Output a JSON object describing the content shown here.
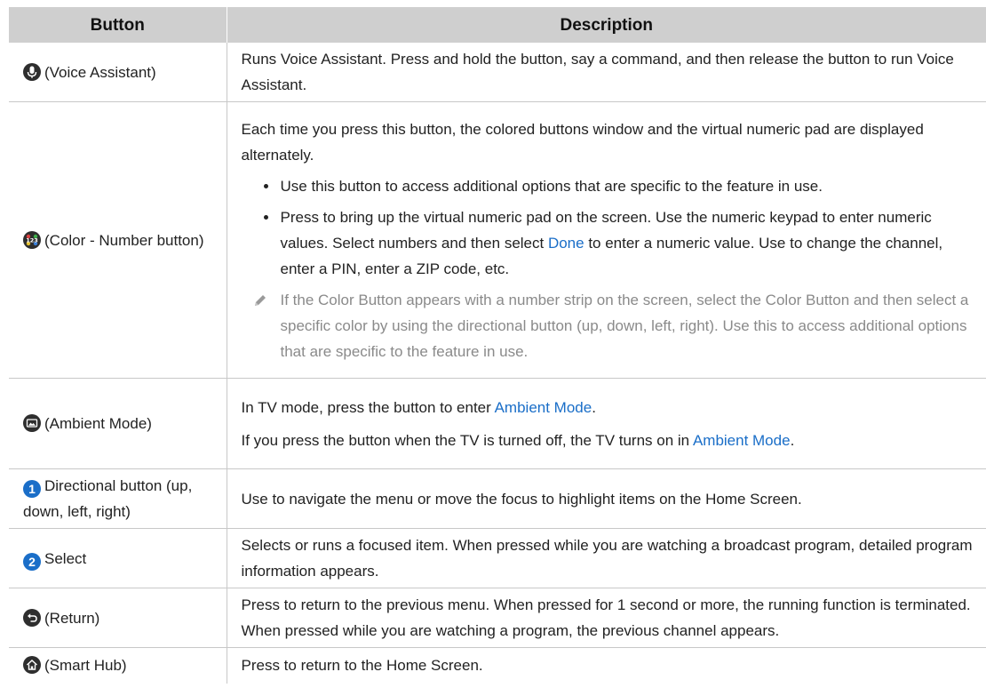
{
  "table": {
    "header": {
      "button": "Button",
      "description": "Description"
    },
    "voice": {
      "icon": "microphone-icon",
      "label": "(Voice Assistant)",
      "desc": "Runs Voice Assistant. Press and hold the button, say a command, and then release the button to run Voice Assistant."
    },
    "color_number": {
      "icon": "color-number-icon",
      "label": "(Color - Number button)",
      "intro": "Each time you press this button, the colored buttons window and the virtual numeric pad are displayed alternately.",
      "bullet1": "Use this button to access additional options that are specific to the feature in use.",
      "bullet2_before": "Press to bring up the virtual numeric pad on the screen. Use the numeric keypad to enter numeric values. Select numbers and then select ",
      "bullet2_link": "Done",
      "bullet2_after": " to enter a numeric value. Use to change the channel, enter a PIN, enter a ZIP code, etc.",
      "note_icon": "pencil-icon",
      "note": "If the Color Button appears with a number strip on the screen, select the Color Button and then select a specific color by using the directional button (up, down, left, right). Use this to access additional options that are specific to the feature in use."
    },
    "ambient": {
      "icon": "ambient-mode-icon",
      "label": "(Ambient Mode)",
      "p1_before": "In TV mode, press the button to enter ",
      "p1_link": "Ambient Mode",
      "p1_after": ".",
      "p2_before": "If you press the button when the TV is turned off, the TV turns on in ",
      "p2_link": "Ambient Mode",
      "p2_after": "."
    },
    "directional": {
      "badge": "1",
      "label": "Directional button (up, down, left, right)",
      "desc": "Use to navigate the menu or move the focus to highlight items on the Home Screen."
    },
    "select": {
      "badge": "2",
      "label": "Select",
      "desc": "Selects or runs a focused item. When pressed while you are watching a broadcast program, detailed program information appears."
    },
    "return": {
      "icon": "return-icon",
      "label": "(Return)",
      "desc": "Press to return to the previous menu. When pressed for 1 second or more, the running function is terminated. When pressed while you are watching a program, the previous channel appears."
    },
    "smart_hub": {
      "icon": "home-icon",
      "label": "(Smart Hub)",
      "desc": "Press to return to the Home Screen."
    }
  },
  "colors": {
    "header_bg": "#cfcfcf",
    "link": "#1a6ec8",
    "note_text": "#8a8a8a",
    "badge": "#1a6ec8"
  }
}
